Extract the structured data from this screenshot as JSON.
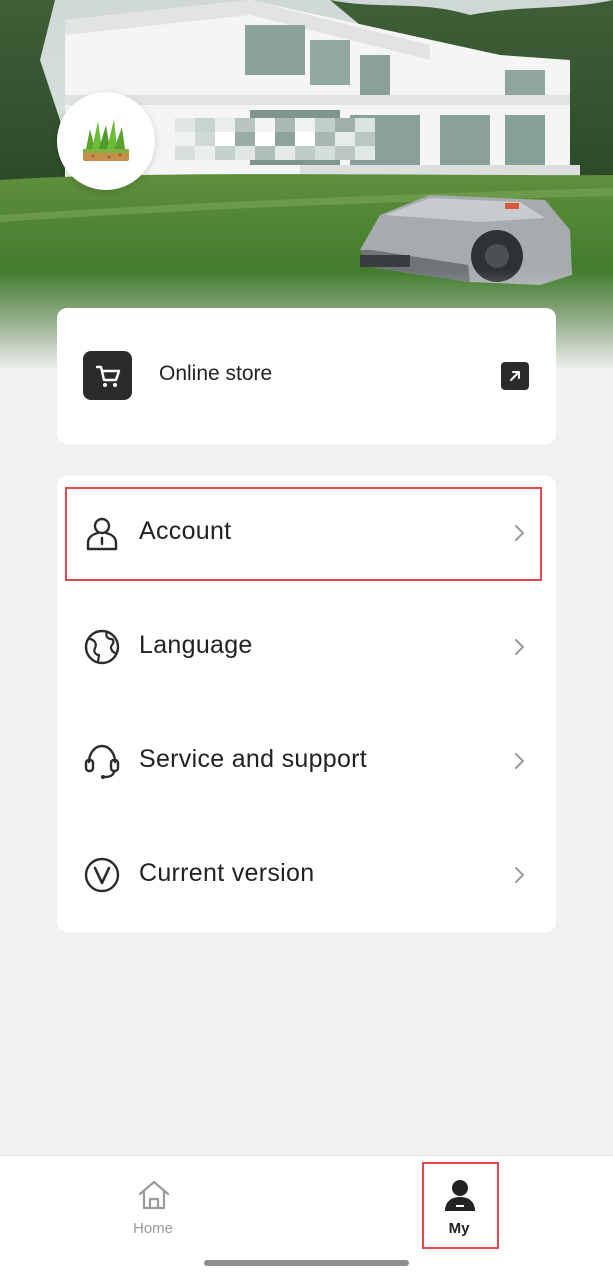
{
  "profile": {
    "avatar_icon": "grass-icon"
  },
  "store": {
    "label": "Online store",
    "icon": "cart-icon",
    "link_icon": "external-link-icon"
  },
  "menu": {
    "items": [
      {
        "label": "Account",
        "icon": "person-icon"
      },
      {
        "label": "Language",
        "icon": "globe-icon"
      },
      {
        "label": "Service and support",
        "icon": "headset-icon"
      },
      {
        "label": "Current version",
        "icon": "version-icon"
      }
    ]
  },
  "tabbar": {
    "tabs": [
      {
        "label": "Home",
        "icon": "home-icon"
      },
      {
        "label": "My",
        "icon": "user-icon"
      }
    ]
  },
  "colors": {
    "highlight": "#e5484d",
    "background": "#f1f1f1",
    "icon_dark": "#2b2b2b"
  }
}
